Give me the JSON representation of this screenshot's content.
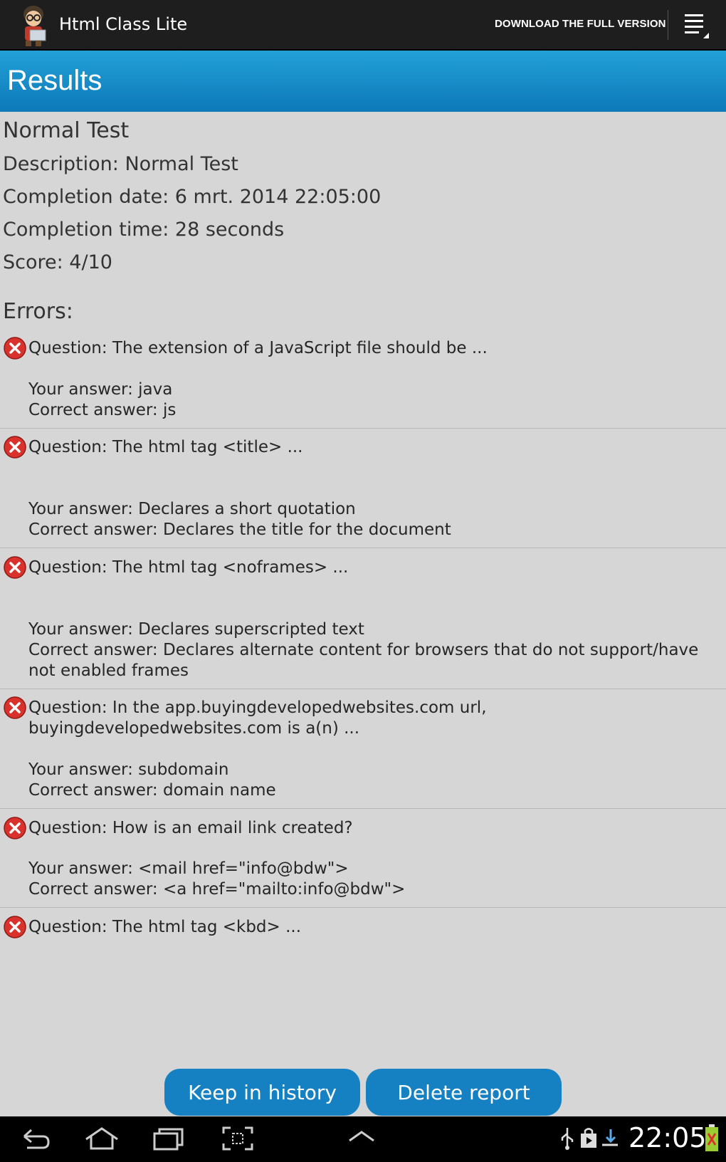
{
  "actionbar": {
    "app_title": "Html Class Lite",
    "download_label": "DOWNLOAD THE FULL VERSION",
    "icons": [
      "app-mascot-icon",
      "overflow-menu-icon"
    ]
  },
  "header": {
    "title": "Results"
  },
  "summary": {
    "test_name": "Normal Test",
    "description": "Description: Normal Test",
    "completion_date": "Completion date: 6 mrt. 2014 22:05:00",
    "completion_time": "Completion time: 28 seconds",
    "score": "Score: 4/10"
  },
  "errors": {
    "heading": "Errors:",
    "items": [
      {
        "question": "Question: The extension of a JavaScript file should be ...",
        "your_answer": "Your answer: java",
        "correct_answer": "Correct answer: js"
      },
      {
        "question": "Question: The html tag <title> ...",
        "your_answer": "Your answer: Declares a short quotation",
        "correct_answer": "Correct answer: Declares the title for the document"
      },
      {
        "question": "Question: The html tag <noframes> ...",
        "your_answer": "Your answer: Declares superscripted text",
        "correct_answer": "Correct answer: Declares alternate content for browsers that do not support/have not enabled frames"
      },
      {
        "question": "Question: In the app.buyingdevelopedwebsites.com url, buyingdevelopedwebsites.com is a(n) ...",
        "your_answer": "Your answer: subdomain",
        "correct_answer": "Correct answer: domain name"
      },
      {
        "question": "Question: How is an email link created?",
        "your_answer": "Your answer: <mail href=\"info@bdw\">",
        "correct_answer": "Correct answer: <a href=\"mailto:info@bdw\">"
      },
      {
        "question": "Question: The html tag <kbd> ..."
      }
    ]
  },
  "buttons": {
    "keep_label": "Keep in history",
    "delete_label": "Delete report"
  },
  "status_bar": {
    "time": "22:05",
    "icons": [
      "back-icon",
      "home-icon",
      "recent-apps-icon",
      "screenshot-icon",
      "up-chevron-icon",
      "usb-icon",
      "shopping-bag-icon",
      "download-icon",
      "battery-icon"
    ]
  },
  "colors": {
    "header_blue": "#1581c2",
    "error_red": "#d9312b",
    "background": "#d6d6d6"
  }
}
